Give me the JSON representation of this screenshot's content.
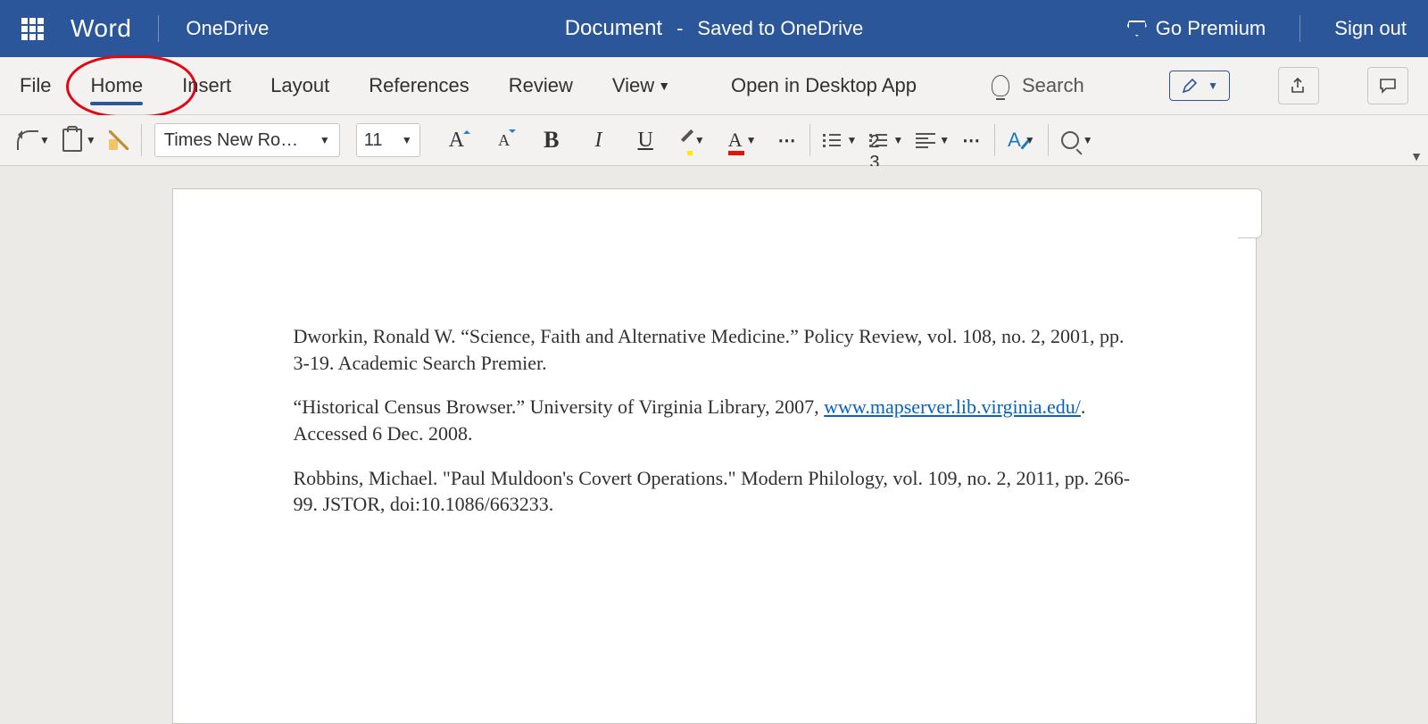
{
  "titlebar": {
    "app": "Word",
    "location": "OneDrive",
    "doc_title": "Document",
    "sep": "-",
    "status": "Saved to OneDrive",
    "premium": "Go Premium",
    "signout": "Sign out"
  },
  "tabs": {
    "items": [
      "File",
      "Home",
      "Insert",
      "Layout",
      "References",
      "Review",
      "View"
    ],
    "active_index": 1,
    "open_in_desktop": "Open in Desktop App",
    "search_placeholder": "Search"
  },
  "ribbon": {
    "font_name": "Times New Ro…",
    "font_size": "11",
    "more": "⋯"
  },
  "document": {
    "paragraphs": [
      {
        "pre": "Dworkin, Ronald W. “Science, Faith and Alternative Medicine.” Policy Review, vol. 108, no. 2, 2001, pp. 3-19. Academic Search Premier."
      },
      {
        "pre": "“Historical Census Browser.” University of Virginia Library, 2007, ",
        "link": "www.mapserver.lib.virginia.edu/",
        "post": ". Accessed 6 Dec. 2008."
      },
      {
        "pre": "Robbins, Michael. \"Paul Muldoon's Covert Operations.\" Modern Philology, vol. 109, no. 2, 2011, pp. 266-99. JSTOR, doi:10.1086/663233."
      }
    ]
  }
}
